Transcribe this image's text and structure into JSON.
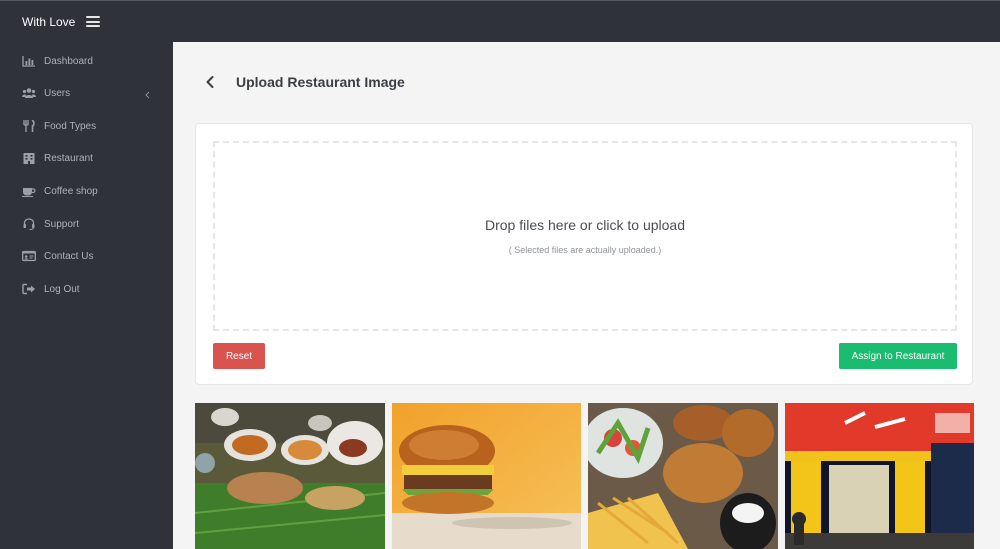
{
  "app": {
    "brand": "With Love"
  },
  "sidebar": {
    "items": [
      {
        "label": "Dashboard",
        "icon": "chart-icon"
      },
      {
        "label": "Users",
        "icon": "users-icon"
      },
      {
        "label": "Food Types",
        "icon": "utensils-icon"
      },
      {
        "label": "Restaurant",
        "icon": "building-icon"
      },
      {
        "label": "Coffee shop",
        "icon": "coffee-icon"
      },
      {
        "label": "Support",
        "icon": "headset-icon"
      },
      {
        "label": "Contact Us",
        "icon": "id-card-icon"
      },
      {
        "label": "Log Out",
        "icon": "sign-out-icon"
      }
    ]
  },
  "page": {
    "title": "Upload Restaurant Image"
  },
  "dropzone": {
    "title": "Drop files here or click to upload",
    "subtitle": "( Selected files are actually uploaded.)"
  },
  "actions": {
    "reset": "Reset",
    "assign": "Assign to Restaurant"
  },
  "gallery": [
    "thali-meal",
    "burger",
    "fast-food-platter",
    "pizza-storefront"
  ],
  "colors": {
    "sidebar": "#2f3239",
    "danger": "#d9534f",
    "success": "#1abc6f",
    "content_bg": "#f4f4f4"
  }
}
